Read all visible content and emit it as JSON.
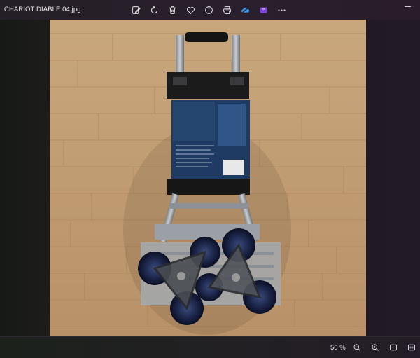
{
  "window": {
    "title": "CHARIOT DIABLE 04.jpg"
  },
  "toolbar": {
    "items": [
      {
        "name": "edit-icon"
      },
      {
        "name": "rotate-icon"
      },
      {
        "name": "delete-icon"
      },
      {
        "name": "favorite-icon"
      },
      {
        "name": "info-icon"
      },
      {
        "name": "print-icon"
      },
      {
        "name": "cloud-icon"
      },
      {
        "name": "clipchamp-icon"
      },
      {
        "name": "more-icon"
      }
    ]
  },
  "status": {
    "zoom_label": "50 %"
  },
  "colors": {
    "accent": "#4aa3f0",
    "purple": "#7b43d6"
  }
}
